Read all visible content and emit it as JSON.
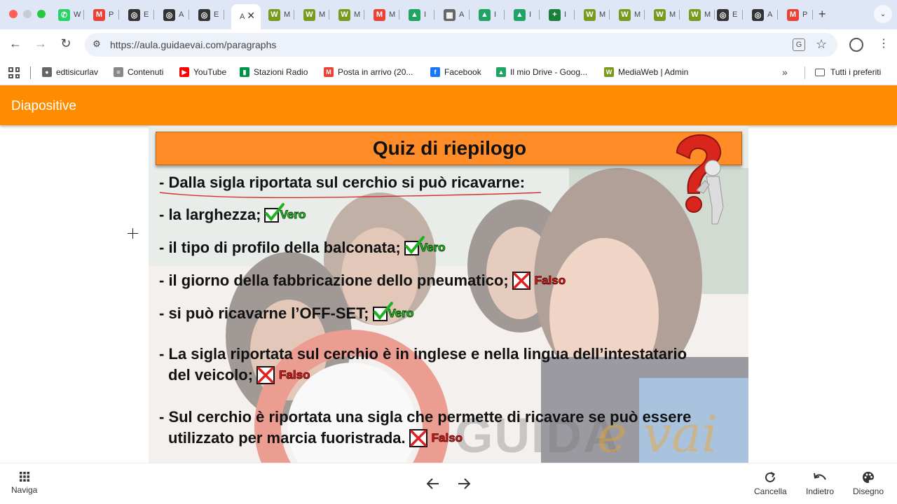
{
  "browser": {
    "tabs": [
      {
        "icon": "whatsapp-icon",
        "title": "W",
        "color": "#25d366",
        "glyph": "✆"
      },
      {
        "icon": "gmail-icon",
        "title": "P",
        "color": "#ea4335",
        "glyph": "M"
      },
      {
        "icon": "steering-wheel-icon",
        "title": "E",
        "color": "#333333",
        "glyph": "◎"
      },
      {
        "icon": "steering-wheel-icon",
        "title": "A",
        "color": "#333333",
        "glyph": "◎"
      },
      {
        "icon": "steering-wheel-icon",
        "title": "E",
        "color": "#333333",
        "glyph": "◎"
      },
      {
        "icon": "mediaweb-icon",
        "title": "M",
        "color": "#7a9a1e",
        "glyph": "W"
      },
      {
        "icon": "mediaweb-icon",
        "title": "M",
        "color": "#7a9a1e",
        "glyph": "W"
      },
      {
        "icon": "mediaweb-icon",
        "title": "M",
        "color": "#7a9a1e",
        "glyph": "W"
      },
      {
        "icon": "gmail-icon",
        "title": "M",
        "color": "#ea4335",
        "glyph": "M"
      },
      {
        "icon": "google-drive-icon",
        "title": "I",
        "color": "#1fa463",
        "glyph": "▲"
      },
      {
        "icon": "video-icon",
        "title": "A",
        "color": "#666666",
        "glyph": "▦"
      },
      {
        "icon": "google-drive-icon",
        "title": "I",
        "color": "#1fa463",
        "glyph": "▲"
      },
      {
        "icon": "google-drive-icon",
        "title": "I",
        "color": "#1fa463",
        "glyph": "▲"
      },
      {
        "icon": "sheets-icon",
        "title": "I",
        "color": "#188038",
        "glyph": "+"
      },
      {
        "icon": "mediaweb-icon",
        "title": "M",
        "color": "#7a9a1e",
        "glyph": "W"
      },
      {
        "icon": "mediaweb-icon",
        "title": "M",
        "color": "#7a9a1e",
        "glyph": "W"
      },
      {
        "icon": "mediaweb-icon",
        "title": "M",
        "color": "#7a9a1e",
        "glyph": "W"
      },
      {
        "icon": "mediaweb-icon",
        "title": "M",
        "color": "#7a9a1e",
        "glyph": "W"
      },
      {
        "icon": "steering-wheel-icon",
        "title": "E",
        "color": "#333333",
        "glyph": "◎"
      },
      {
        "icon": "steering-wheel-icon",
        "title": "A",
        "color": "#333333",
        "glyph": "◎"
      },
      {
        "icon": "gmail-icon",
        "title": "P",
        "color": "#ea4335",
        "glyph": "M"
      }
    ],
    "active_tab": {
      "title": "A",
      "close_glyph": "✕"
    },
    "new_tab_glyph": "+",
    "tab_menu_glyph": "⌄",
    "back_glyph": "←",
    "forward_glyph": "→",
    "reload_glyph": "↻",
    "url": "https://aula.guidaevai.com/paragraphs",
    "translate_glyph": "G",
    "star_glyph": "☆",
    "menu_glyph": "⋮",
    "bookmarks": [
      {
        "label": "edtisicurlav",
        "icon": "site-icon",
        "color": "#666666",
        "glyph": "●"
      },
      {
        "label": "Contenuti",
        "icon": "stack-icon",
        "color": "#888888",
        "glyph": "≡"
      },
      {
        "label": "YouTube",
        "icon": "youtube-icon",
        "color": "#ff0000",
        "glyph": "▶"
      },
      {
        "label": "Stazioni Radio",
        "icon": "italy-flag-icon",
        "color": "#009246",
        "glyph": "▮"
      },
      {
        "label": "Posta in arrivo (20...",
        "icon": "gmail-icon",
        "color": "#ea4335",
        "glyph": "M"
      },
      {
        "label": "Facebook",
        "icon": "facebook-icon",
        "color": "#1877f2",
        "glyph": "f"
      },
      {
        "label": "Il mio Drive - Goog...",
        "icon": "google-drive-icon",
        "color": "#1fa463",
        "glyph": "▲"
      },
      {
        "label": "MediaWeb | Admin",
        "icon": "mediaweb-icon",
        "color": "#7a9a1e",
        "glyph": "W"
      }
    ],
    "more_bookmarks_glyph": "»",
    "all_bookmarks_label": "Tutti i preferiti"
  },
  "app": {
    "title": "Diapositive",
    "accent_color": "#ff8c00"
  },
  "slide": {
    "title": "Quiz di riepilogo",
    "question": "- Dalla sigla riportata sul cerchio si può ricavarne:",
    "vero_label": "Vero",
    "falso_label": "Falso",
    "items": [
      {
        "text": "- la larghezza;",
        "answer": "vero"
      },
      {
        "text": "- il tipo di profilo della balconata;",
        "answer": "vero"
      },
      {
        "text": "- il giorno della fabbricazione dello pneumatico;",
        "answer": "falso"
      },
      {
        "text": "- si può ricavarne l’OFF-SET;",
        "answer": "vero"
      },
      {
        "text_line1": "- La sigla riportata sul cerchio è in inglese e nella lingua dell’intestatario",
        "text_line2": "del veicolo;",
        "answer": "falso"
      },
      {
        "text_line1": "- Sul cerchio è riportata una sigla che permette di ricavare se può essere",
        "text_line2": "utilizzato per marcia fuoristrada.",
        "answer": "falso"
      }
    ],
    "watermark_1": "GUIDA",
    "watermark_2": "e vai"
  },
  "bottom_bar": {
    "nav_label": "Naviga",
    "cancel_label": "Cancella",
    "back_label": "Indietro",
    "draw_label": "Disegno"
  }
}
